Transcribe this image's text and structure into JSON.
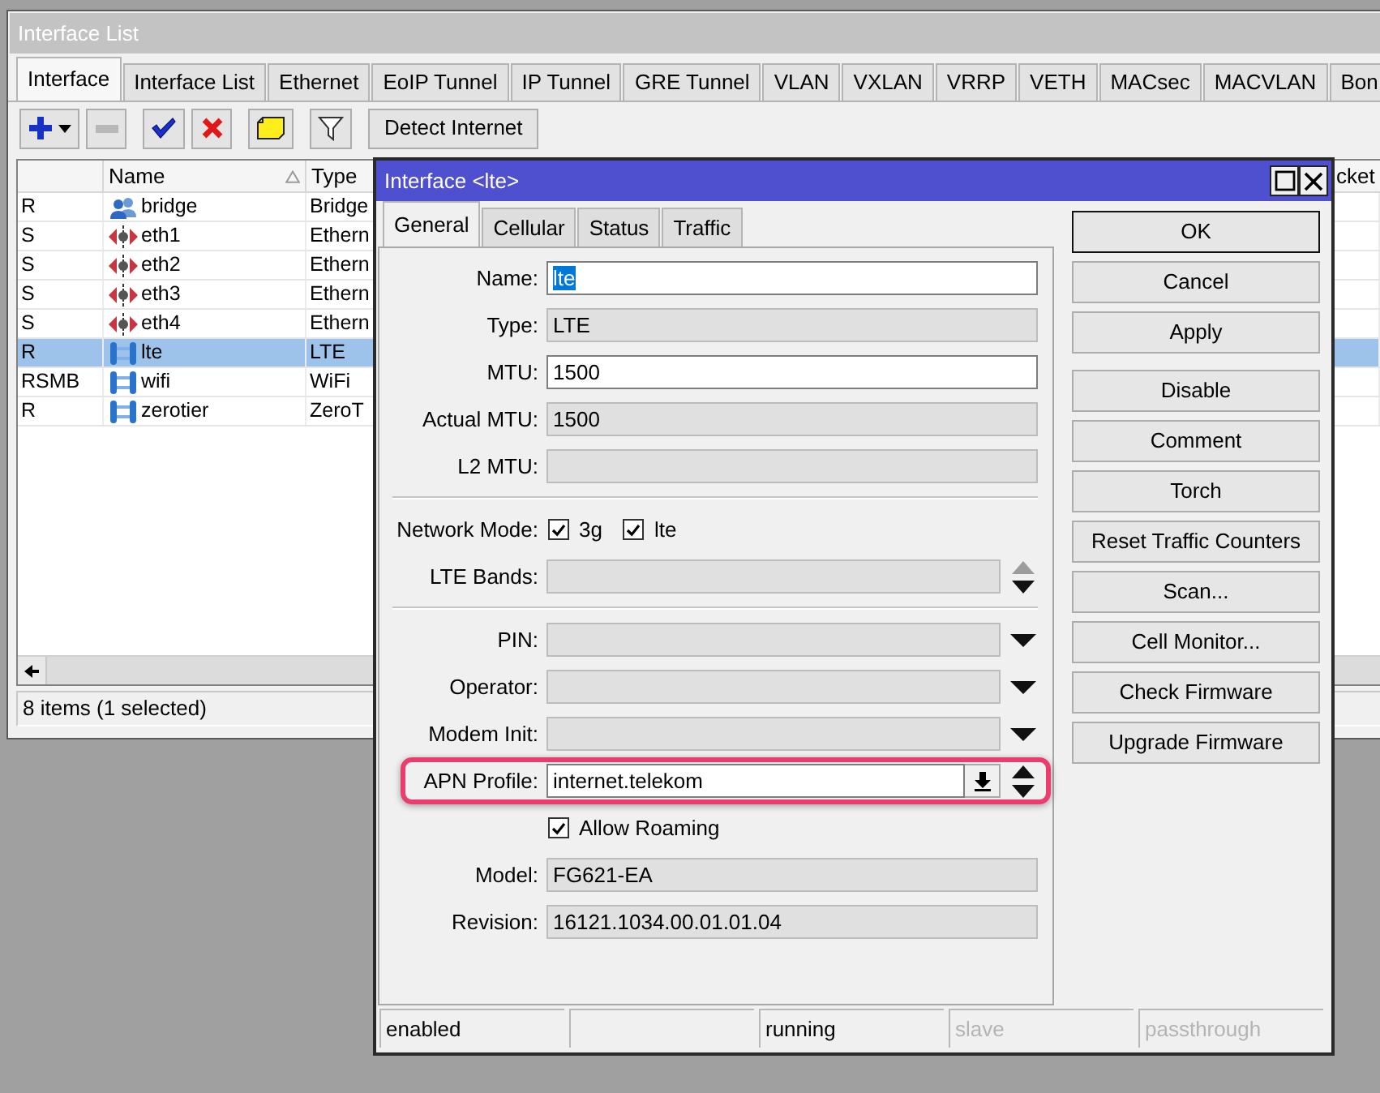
{
  "main_window": {
    "title": "Interface List",
    "tabs": [
      {
        "label": "Interface",
        "selected": true
      },
      {
        "label": "Interface List",
        "selected": false
      },
      {
        "label": "Ethernet",
        "selected": false
      },
      {
        "label": "EoIP Tunnel",
        "selected": false
      },
      {
        "label": "IP Tunnel",
        "selected": false
      },
      {
        "label": "GRE Tunnel",
        "selected": false
      },
      {
        "label": "VLAN",
        "selected": false
      },
      {
        "label": "VXLAN",
        "selected": false
      },
      {
        "label": "VRRP",
        "selected": false
      },
      {
        "label": "VETH",
        "selected": false
      },
      {
        "label": "MACsec",
        "selected": false
      },
      {
        "label": "MACVLAN",
        "selected": false
      },
      {
        "label": "Bon",
        "selected": false
      }
    ],
    "toolbar": [
      [
        {
          "kind": "add",
          "disabled": false
        },
        {
          "kind": "remove",
          "disabled": true
        }
      ],
      [
        {
          "kind": "enable",
          "disabled": false
        },
        {
          "kind": "disable",
          "disabled": false
        }
      ],
      [
        {
          "kind": "comment",
          "disabled": false
        }
      ],
      [
        {
          "kind": "filter",
          "disabled": false
        }
      ],
      [
        {
          "kind": "text",
          "label": "Detect Internet",
          "disabled": false
        }
      ]
    ],
    "table": {
      "columns": [
        {
          "sorted": false
        },
        {
          "label": "Name",
          "sorted": true
        },
        {
          "label": "Type",
          "sorted": false
        },
        {
          "label": "cket",
          "sorted": false
        }
      ],
      "rows": [
        {
          "flags": "R",
          "kind": "bridge",
          "name": "bridge",
          "type": "Bridge",
          "selected": false
        },
        {
          "flags": "S",
          "kind": "ethernet",
          "name": "eth1",
          "type": "Ethern",
          "selected": false
        },
        {
          "flags": "S",
          "kind": "ethernet",
          "name": "eth2",
          "type": "Ethern",
          "selected": false
        },
        {
          "flags": "S",
          "kind": "ethernet",
          "name": "eth3",
          "type": "Ethern",
          "selected": false
        },
        {
          "flags": "S",
          "kind": "ethernet",
          "name": "eth4",
          "type": "Ethern",
          "selected": false
        },
        {
          "flags": "R",
          "kind": "link",
          "name": "lte",
          "type": "LTE",
          "selected": true
        },
        {
          "flags": "RSMB",
          "kind": "link",
          "name": "wifi",
          "type": "WiFi",
          "selected": false
        },
        {
          "flags": "R",
          "kind": "link",
          "name": "zerotier",
          "type": "ZeroT",
          "selected": false
        }
      ]
    },
    "status": "8 items (1 selected)"
  },
  "dialog": {
    "title": "Interface <lte>",
    "tabs": [
      {
        "label": "General",
        "selected": true
      },
      {
        "label": "Cellular",
        "selected": false
      },
      {
        "label": "Status",
        "selected": false
      },
      {
        "label": "Traffic",
        "selected": false
      }
    ],
    "sections": [
      [
        {
          "kind": "field",
          "label": "Name:",
          "value": "lte",
          "readonly": false,
          "text_selected": true,
          "highlighted": false
        },
        {
          "kind": "field",
          "label": "Type:",
          "value": "LTE",
          "readonly": true,
          "text_selected": false,
          "highlighted": false
        },
        {
          "kind": "field",
          "label": "MTU:",
          "value": "1500",
          "readonly": false,
          "text_selected": false,
          "highlighted": false
        },
        {
          "kind": "field",
          "label": "Actual MTU:",
          "value": "1500",
          "readonly": true,
          "text_selected": false,
          "highlighted": false
        },
        {
          "kind": "field",
          "label": "L2 MTU:",
          "readonly": true,
          "highlighted": false
        }
      ],
      [
        {
          "kind": "checks",
          "label": "Network Mode:",
          "options": [
            {
              "label": "3g",
              "checked": true
            },
            {
              "label": "lte",
              "checked": true
            }
          ],
          "highlighted": false
        },
        {
          "kind": "field",
          "label": "LTE Bands:",
          "readonly": true,
          "spinner": true,
          "up_disabled": true,
          "highlighted": false
        }
      ],
      [
        {
          "kind": "field",
          "label": "PIN:",
          "readonly": true,
          "dropdown": true,
          "highlighted": false
        },
        {
          "kind": "field",
          "label": "Operator:",
          "readonly": true,
          "dropdown": true,
          "highlighted": false
        },
        {
          "kind": "field",
          "label": "Modem Init:",
          "readonly": true,
          "dropdown": true,
          "highlighted": false
        },
        {
          "kind": "field",
          "label": "APN Profile:",
          "value": "internet.telekom",
          "readonly": false,
          "text_selected": false,
          "combo": true,
          "spinner": true,
          "up_disabled": false,
          "highlighted": true
        },
        {
          "kind": "checkbox",
          "label": "Allow Roaming",
          "checked": true,
          "highlighted": false
        },
        {
          "kind": "field",
          "label": "Model:",
          "value": "FG621-EA",
          "readonly": true,
          "text_selected": false,
          "highlighted": false
        },
        {
          "kind": "field",
          "label": "Revision:",
          "value": "16121.1034.00.01.01.04",
          "readonly": true,
          "text_selected": false,
          "highlighted": false
        }
      ]
    ],
    "button_groups": [
      [
        {
          "label": "OK",
          "default": true
        },
        {
          "label": "Cancel",
          "default": false
        },
        {
          "label": "Apply",
          "default": false
        }
      ],
      [
        {
          "label": "Disable",
          "default": false
        },
        {
          "label": "Comment",
          "default": false
        },
        {
          "label": "Torch",
          "default": false
        },
        {
          "label": "Reset Traffic Counters",
          "default": false
        },
        {
          "label": "Scan...",
          "default": false
        },
        {
          "label": "Cell Monitor...",
          "default": false
        },
        {
          "label": "Check Firmware",
          "default": false
        },
        {
          "label": "Upgrade Firmware",
          "default": false
        }
      ]
    ],
    "status_bar": [
      {
        "kind": "text",
        "text": "enabled",
        "disabled": false
      },
      {
        "kind": "blank"
      },
      {
        "kind": "text",
        "text": "running",
        "disabled": false
      },
      {
        "kind": "text",
        "text": "slave",
        "disabled": true
      },
      {
        "kind": "text",
        "text": "passthrough",
        "disabled": true
      }
    ]
  }
}
